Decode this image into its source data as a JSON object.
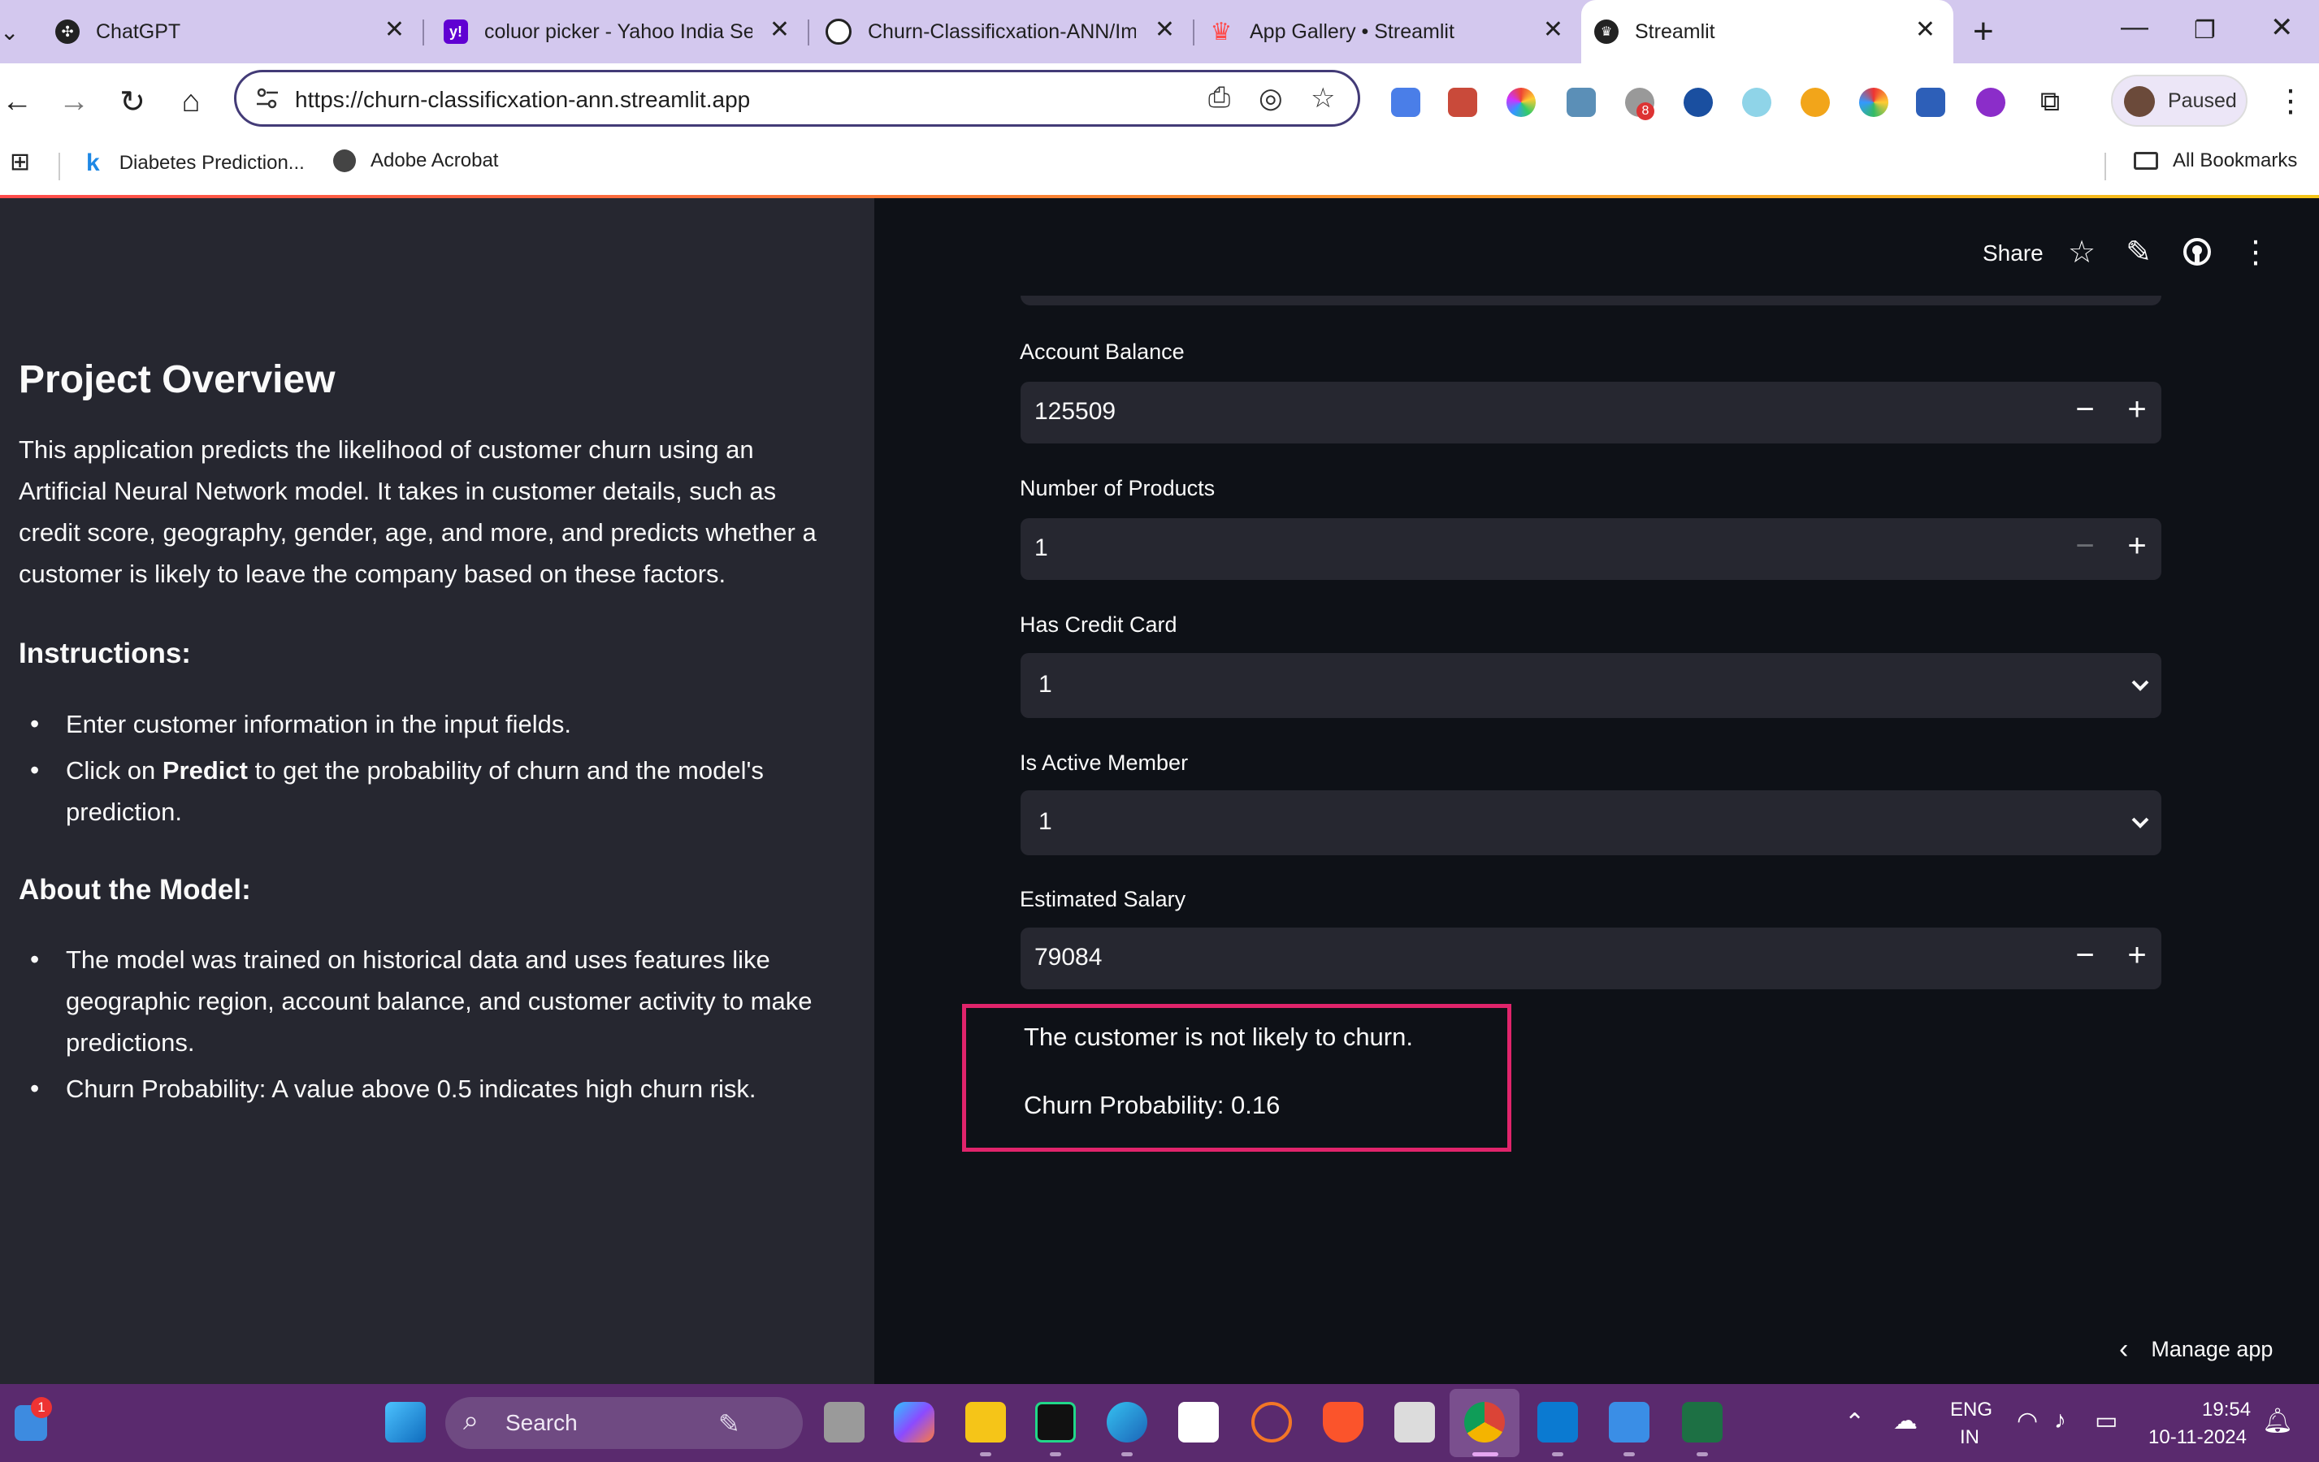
{
  "browser": {
    "tabs": [
      {
        "title": "ChatGPT",
        "active": false
      },
      {
        "title": "coluor picker - Yahoo India Sea",
        "active": false
      },
      {
        "title": "Churn-Classificxation-ANN/Ima",
        "active": false
      },
      {
        "title": "App Gallery • Streamlit",
        "active": false
      },
      {
        "title": "Streamlit",
        "active": true
      }
    ],
    "url": "https://churn-classificxation-ann.streamlit.app",
    "extension_badge": "8",
    "profile_label": "Paused",
    "bookmarks": [
      {
        "label": "Diabetes Prediction..."
      },
      {
        "label": "Adobe Acrobat"
      }
    ],
    "all_bookmarks_label": "All Bookmarks"
  },
  "sidebar": {
    "title": "Project Overview",
    "intro": "This application predicts the likelihood of customer churn using an Artificial Neural Network model. It takes in customer details, such as credit score, geography, gender, age, and more, and predicts whether a customer is likely to leave the company based on these factors.",
    "instructions_heading": "Instructions:",
    "instructions": [
      {
        "text": "Enter customer information in the input fields."
      },
      {
        "prefix": "Click on ",
        "bold": "Predict",
        "suffix": " to get the probability of churn and the model's prediction."
      }
    ],
    "model_heading": "About the Model:",
    "model_points": [
      "The model was trained on historical data and uses features like geographic region, account balance, and customer activity to make predictions.",
      "Churn Probability: A value above 0.5 indicates high churn risk."
    ]
  },
  "header": {
    "share_label": "Share",
    "icons": [
      "star-icon",
      "pencil-icon",
      "github-icon",
      "more-vert-icon"
    ]
  },
  "form": {
    "account_balance": {
      "label": "Account Balance",
      "value": "125509"
    },
    "num_products": {
      "label": "Number of Products",
      "value": "1"
    },
    "has_credit_card": {
      "label": "Has Credit Card",
      "value": "1"
    },
    "is_active_member": {
      "label": "Is Active Member",
      "value": "1"
    },
    "estimated_salary": {
      "label": "Estimated Salary",
      "value": "79084"
    }
  },
  "result": {
    "message": "The customer is not likely to churn.",
    "probability": "Churn Probability: 0.16",
    "highlight_color": "#e0246b"
  },
  "manage_app_label": "Manage app",
  "taskbar": {
    "search_placeholder": "Search",
    "widget_badge": "1",
    "language": "ENG",
    "region": "IN",
    "time": "19:54",
    "date": "10-11-2024"
  },
  "theme": {
    "sidebar_bg": "#262730",
    "main_bg": "#0e1117",
    "input_bg": "#262730",
    "text": "#fafafa",
    "tabstrip_bg": "#d3c8ee",
    "taskbar_bg": "#5a2a6e"
  }
}
